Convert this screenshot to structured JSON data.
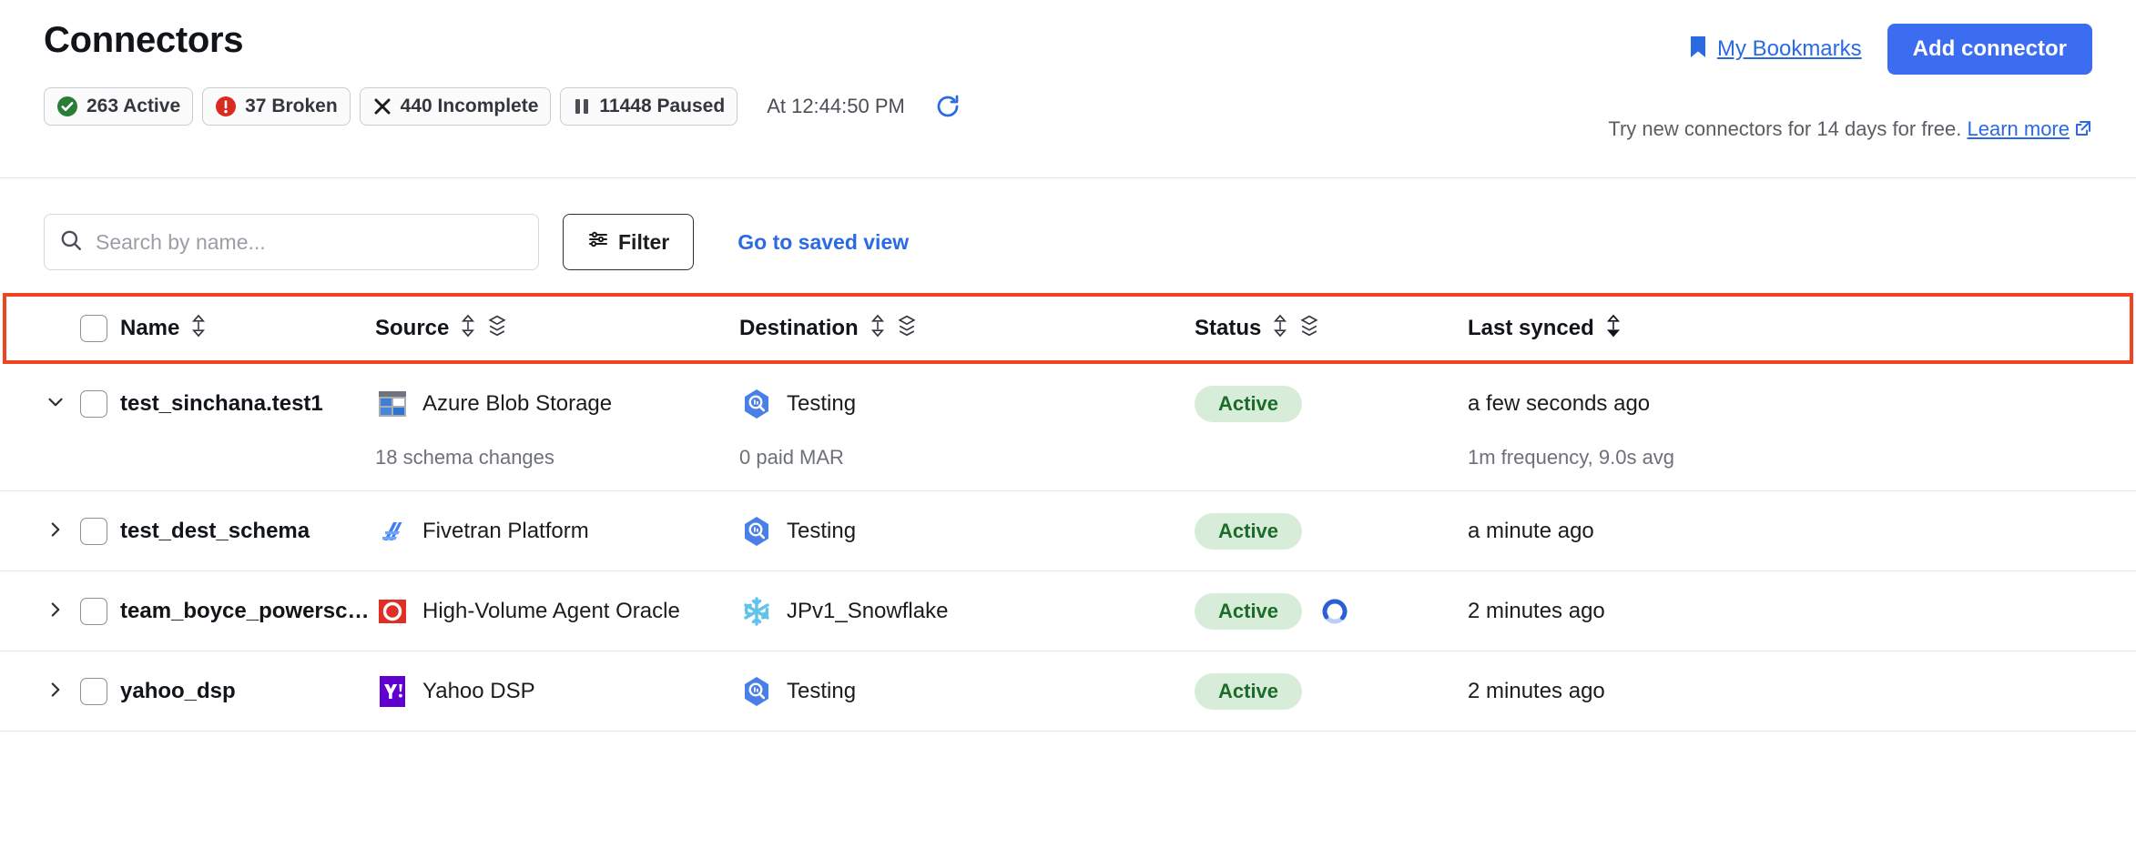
{
  "header": {
    "title": "Connectors",
    "bookmarks_label": "My Bookmarks",
    "bookmark_icon": "bookmark-icon",
    "add_connector_label": "Add connector",
    "time_label": "At 12:44:50 PM",
    "refresh_icon": "refresh-icon",
    "promo_text": "Try new connectors for 14 days for free.",
    "promo_link": "Learn more",
    "promo_link_icon": "external-link-icon",
    "chips": [
      {
        "icon": "check-circle-icon",
        "label": "263 Active",
        "color": "#2a7d36"
      },
      {
        "icon": "exclamation-circle-icon",
        "label": "37 Broken",
        "color": "#d92b20"
      },
      {
        "icon": "x-icon",
        "label": "440 Incomplete",
        "color": "#1b1c1d"
      },
      {
        "icon": "pause-icon",
        "label": "11448 Paused",
        "color": "#4b4f55"
      }
    ]
  },
  "toolbar": {
    "search_placeholder": "Search by name...",
    "search_value": "",
    "search_icon": "search-icon",
    "filter_label": "Filter",
    "filter_icon": "sliders-icon",
    "saved_view_label": "Go to saved view"
  },
  "table": {
    "highlight_color": "#f04322",
    "columns": [
      {
        "label": "Name",
        "sort": "sort-both-icon",
        "group": null
      },
      {
        "label": "Source",
        "sort": "sort-both-icon",
        "group": "layers-icon"
      },
      {
        "label": "Destination",
        "sort": "sort-both-icon",
        "group": "layers-icon"
      },
      {
        "label": "Status",
        "sort": "sort-both-icon",
        "group": "layers-icon"
      },
      {
        "label": "Last synced",
        "sort": "sort-desc-icon",
        "group": null
      }
    ],
    "select_all_checked": false,
    "rows": [
      {
        "caret": "chevron-down-icon",
        "expanded": true,
        "checked": false,
        "name": "test_sinchana.test1",
        "source_icon": "azure-blob-storage-icon",
        "source": "Azure Blob Storage",
        "destination_icon": "bigquery-icon",
        "destination": "Testing",
        "status": "Active",
        "syncing": false,
        "last_synced": "a few seconds ago",
        "detail_source": "18 schema changes",
        "detail_destination": "0 paid MAR",
        "detail_sync": "1m frequency, 9.0s avg"
      },
      {
        "caret": "chevron-right-icon",
        "expanded": false,
        "checked": false,
        "name": "test_dest_schema",
        "source_icon": "fivetran-platform-icon",
        "source": "Fivetran Platform",
        "destination_icon": "bigquery-icon",
        "destination": "Testing",
        "status": "Active",
        "syncing": false,
        "last_synced": "a minute ago"
      },
      {
        "caret": "chevron-right-icon",
        "expanded": false,
        "checked": false,
        "name": "team_boyce_powerschool_...",
        "source_icon": "oracle-icon",
        "source": "High-Volume Agent Oracle",
        "destination_icon": "snowflake-icon",
        "destination": "JPv1_Snowflake",
        "status": "Active",
        "syncing": true,
        "last_synced": "2 minutes ago"
      },
      {
        "caret": "chevron-right-icon",
        "expanded": false,
        "checked": false,
        "name": "yahoo_dsp",
        "source_icon": "yahoo-dsp-icon",
        "source": "Yahoo DSP",
        "destination_icon": "bigquery-icon",
        "destination": "Testing",
        "status": "Active",
        "syncing": false,
        "last_synced": "2 minutes ago"
      }
    ]
  }
}
